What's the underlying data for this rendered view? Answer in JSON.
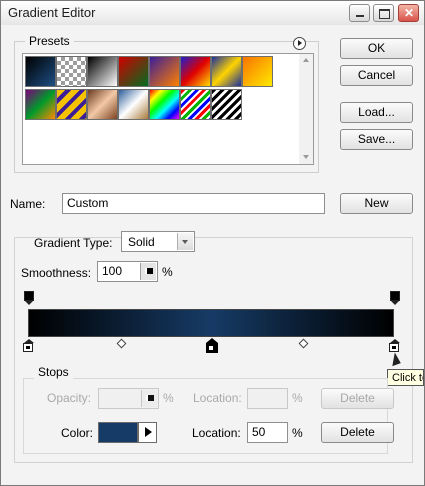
{
  "window": {
    "title": "Gradient Editor"
  },
  "buttons": {
    "ok": "OK",
    "cancel": "Cancel",
    "load": "Load...",
    "save": "Save...",
    "new": "New",
    "delete": "Delete"
  },
  "presets": {
    "label": "Presets",
    "swatches": [
      {
        "name": "preset-black-blue",
        "css": "linear-gradient(135deg,#000000,#1d4f84)"
      },
      {
        "name": "preset-transparent-checker",
        "css": "repeating-conic-gradient(#9d9d9d 0% 25%,#ffffff 0% 50%) 0 0/8px 8px"
      },
      {
        "name": "preset-black-white",
        "css": "linear-gradient(135deg,#000000,#ffffff)"
      },
      {
        "name": "preset-red-green",
        "css": "linear-gradient(135deg,#d00000,#006d1f)"
      },
      {
        "name": "preset-violet-orange",
        "css": "linear-gradient(135deg,#3b1e97,#ff7f00)"
      },
      {
        "name": "preset-blue-red-yellow",
        "css": "linear-gradient(135deg,#1e1ecc,#e00000,#ffdd00)"
      },
      {
        "name": "preset-blue-yellow-blue",
        "css": "linear-gradient(135deg,#1a2f9c,#ffd400,#1a2f9c)"
      },
      {
        "name": "preset-orange-yellow",
        "css": "linear-gradient(135deg,#f97300,#ffea00)"
      },
      {
        "name": "preset-violet-green-orange",
        "css": "linear-gradient(135deg,#7d007d,#009a2a,#ff8a00)"
      },
      {
        "name": "preset-yellow-violet-stripes",
        "css": "repeating-linear-gradient(135deg,#f5c200 0 6px,#3b1e97 6px 10px)"
      },
      {
        "name": "preset-copper",
        "css": "linear-gradient(135deg,#6b3a1f,#f2c9a7,#7b4321)"
      },
      {
        "name": "preset-chrome",
        "css": "linear-gradient(135deg,#2e5e9b,#ffffff,#a87b3b)"
      },
      {
        "name": "preset-spectrum",
        "css": "linear-gradient(135deg,#ff0000,#ffff00,#00ff00,#00ffff,#0000ff,#ff00ff)"
      },
      {
        "name": "preset-transparent-rainbow",
        "css": "repeating-linear-gradient(135deg,#ff0000 0 3px,#ffffff 3px 5px,#00b400 5px 8px,#ffffff 8px 10px,#0000ff 10px 13px,#ffffff 13px 15px)"
      },
      {
        "name": "preset-transparent-stripes",
        "css": "repeating-linear-gradient(135deg,#000000 0 3px,#ffffff 3px 6px)"
      }
    ]
  },
  "name_row": {
    "label": "Name:",
    "value": "Custom"
  },
  "gradient": {
    "type_label": "Gradient Type:",
    "type_value": "Solid",
    "smoothness_label": "Smoothness:",
    "smoothness_value": "100",
    "percent": "%",
    "bar_colors": {
      "start": "#000000",
      "middle": "#163b66",
      "end": "#000000"
    }
  },
  "stops": {
    "label": "Stops",
    "opacity_label": "Opacity:",
    "location_label": "Location:",
    "color_label": "Color:",
    "color_value": "#163b66",
    "location_value": "50",
    "percent": "%"
  },
  "tooltip": {
    "text": "Click to"
  }
}
